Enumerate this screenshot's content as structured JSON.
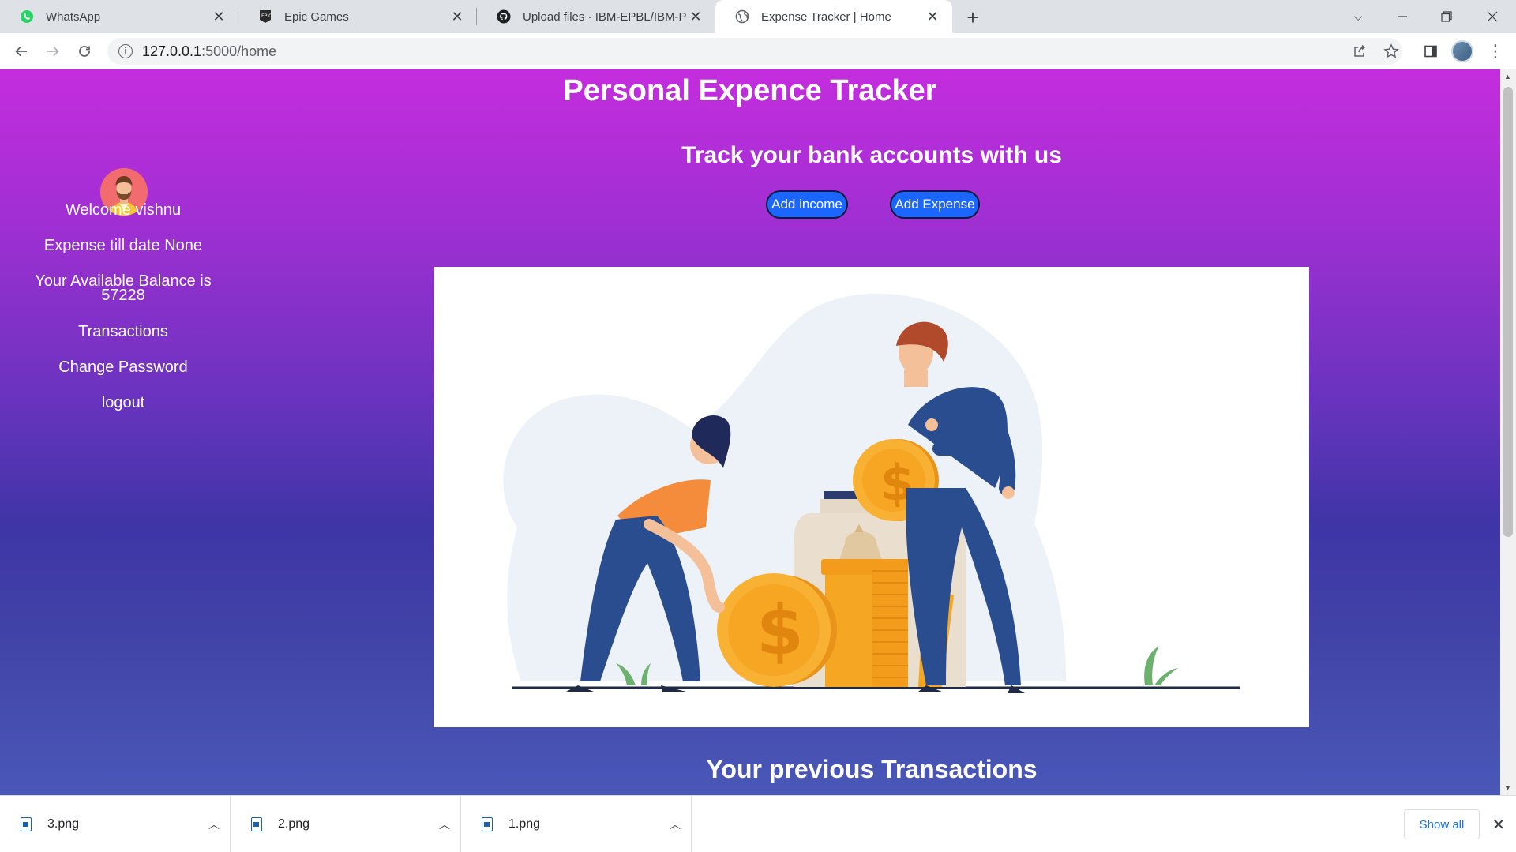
{
  "browser": {
    "tabs": [
      {
        "title": "WhatsApp",
        "icon": "whatsapp-icon"
      },
      {
        "title": "Epic Games",
        "icon": "epic-games-icon"
      },
      {
        "title": "Upload files · IBM-EPBL/IBM-Proj",
        "icon": "github-icon"
      },
      {
        "title": "Expense Tracker | Home",
        "icon": "globe-icon",
        "active": true
      }
    ],
    "url_host": "127.0.0.1",
    "url_path": ":5000/home"
  },
  "page": {
    "title": "Personal Expence Tracker",
    "subtitle": "Track your bank accounts with us",
    "add_income_label": "Add income",
    "add_expense_label": "Add Expense",
    "previous_title": "Your previous Transactions"
  },
  "sidebar": {
    "welcome": "Welcome vishnu",
    "expense": "Expense till date None",
    "balance_line1": "Your Available Balance is",
    "balance_line2": "57228",
    "transactions": "Transactions",
    "change_password": "Change Password",
    "logout": "logout"
  },
  "downloads": {
    "items": [
      "3.png",
      "2.png",
      "1.png"
    ],
    "show_all": "Show all"
  },
  "colors": {
    "accent_button": "#1a66ff",
    "gradient_top": "#c42ddd",
    "gradient_bottom": "#4a58b8"
  }
}
